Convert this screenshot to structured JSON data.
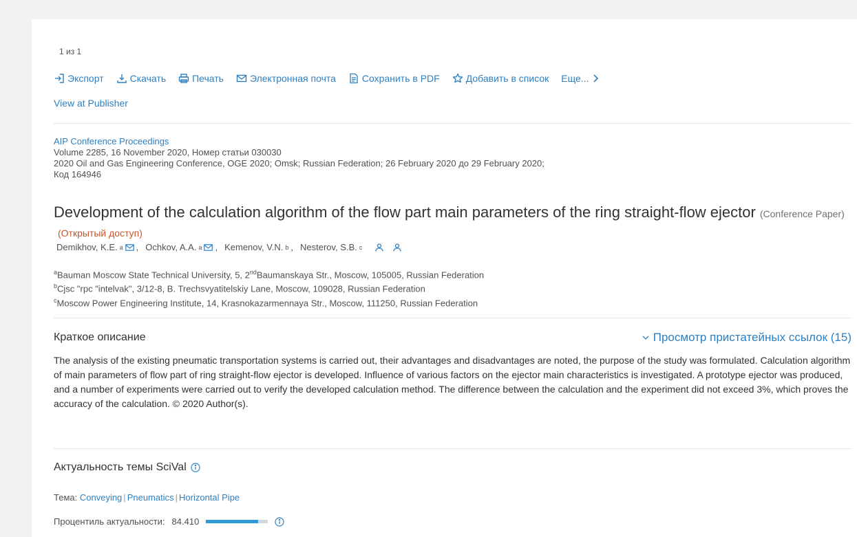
{
  "pager": "1 из 1",
  "toolbar": {
    "export": "Экспорт",
    "download": "Скачать",
    "print": "Печать",
    "email": "Электронная почта",
    "save_pdf": "Сохранить в PDF",
    "add_list": "Добавить в список",
    "more": "Еще..."
  },
  "view_publisher": "View at Publisher",
  "source": {
    "journal": "AIP Conference Proceedings",
    "volume": "Volume 2285, 16 November 2020, Номер статьи 030030",
    "conference": "2020 Oil and Gas Engineering Conference, OGE 2020; Omsk; Russian Federation; 26 February 2020 до 29 February 2020;",
    "code": "Код 164946"
  },
  "title": {
    "text": "Development of the calculation algorithm of the flow part main parameters of the ring straight-flow ejector",
    "type": "(Conference Paper)",
    "access": "(Открытый доступ)"
  },
  "authors": [
    {
      "name": "Demikhov, K.E.",
      "sup": "a"
    },
    {
      "name": "Ochkov, A.A.",
      "sup": "a"
    },
    {
      "name": "Kemenov, V.N.",
      "sup": "b"
    },
    {
      "name": "Nesterov, S.B.",
      "sup": "c"
    }
  ],
  "affiliations": [
    {
      "sup": "a",
      "pre": "Bauman Moscow State Technical University, 5, 2",
      "sup2": "nd",
      "post": "Baumanskaya Str., Moscow, 105005, Russian Federation"
    },
    {
      "sup": "b",
      "pre": "Cjsc \"rpc \"intelvak\", 3/12-8, B. Trechsvyatitelskiy Lane, Moscow, 109028, Russian Federation"
    },
    {
      "sup": "c",
      "pre": "Moscow Power Engineering Institute, 14, Krasnokazarmennaya Str., Moscow, 111250, Russian Federation"
    }
  ],
  "abstract": {
    "heading": "Краткое описание",
    "refs_link": "Просмотр пристатейных ссылок (15)",
    "text": "The analysis of the existing pneumatic transportation systems is carried out, their advantages and disadvantages are noted, the purpose of the study was formulated. Calculation algorithm of main parameters of flow part of ring straight-flow ejector is developed. Influence of various factors on the ejector main characteristics is investigated. A prototype ejector was produced, and a number of experiments were carried out to verify the developed calculation method. The difference between the calculation and the experiment did not exceed 3%, which proves the accuracy of the calculation. © 2020 Author(s)."
  },
  "scival": {
    "heading": "Актуальность темы SciVal",
    "topic_label": "Тема:",
    "topics": [
      "Conveying",
      "Pneumatics",
      "Horizontal Pipe"
    ],
    "percentile_label": "Процентиль актуальности:",
    "percentile_value": "84.410",
    "percentile_fraction": 0.8441
  },
  "colors": {
    "link": "#2e7fc0",
    "open_access": "#c6552a",
    "bar_fill": "#2e9ad8"
  }
}
